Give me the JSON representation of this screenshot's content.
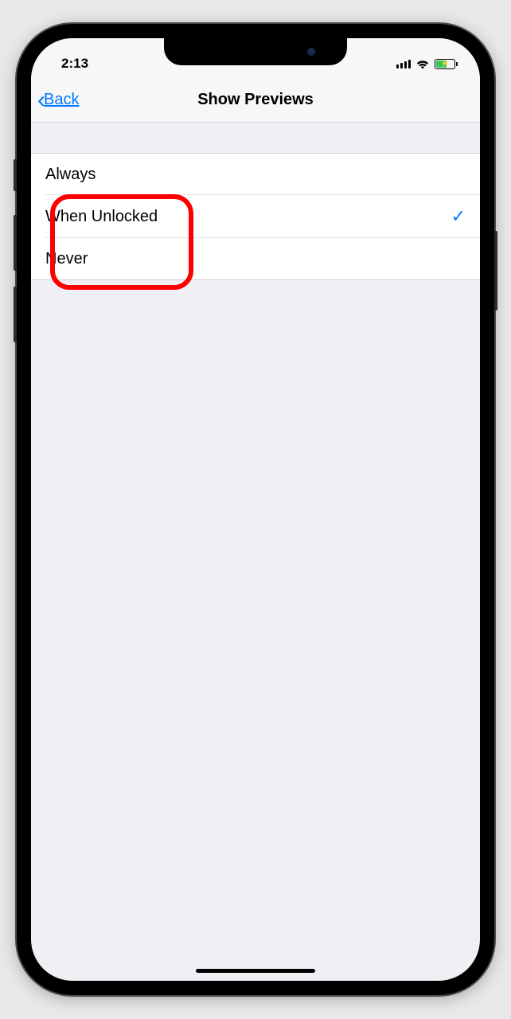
{
  "status_bar": {
    "time": "2:13"
  },
  "nav": {
    "back_label": "Back",
    "title": "Show Previews"
  },
  "options": [
    {
      "label": "Always",
      "selected": false
    },
    {
      "label": "When Unlocked",
      "selected": true
    },
    {
      "label": "Never",
      "selected": false
    }
  ]
}
